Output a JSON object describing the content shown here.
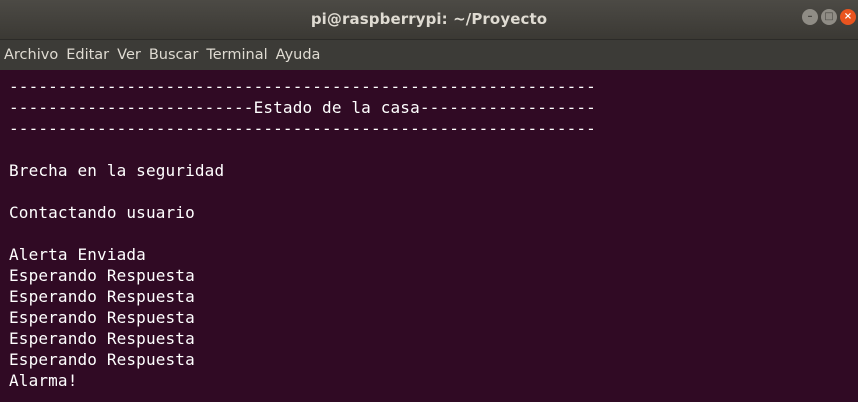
{
  "window": {
    "title": "pi@raspberrypi: ~/Proyecto",
    "controls": {
      "minimize_icon": "minimize-icon",
      "maximize_icon": "maximize-icon",
      "close_icon": "close-icon"
    }
  },
  "menubar": {
    "items": [
      "Archivo",
      "Editar",
      "Ver",
      "Buscar",
      "Terminal",
      "Ayuda"
    ]
  },
  "terminal": {
    "background": "#300a24",
    "foreground": "#ffffff",
    "lines": [
      "------------------------------------------------------------",
      "-------------------------Estado de la casa------------------",
      "------------------------------------------------------------",
      "",
      "Brecha en la seguridad",
      "",
      "Contactando usuario",
      "",
      "Alerta Enviada",
      "Esperando Respuesta",
      "Esperando Respuesta",
      "Esperando Respuesta",
      "Esperando Respuesta",
      "Esperando Respuesta",
      "Alarma!"
    ]
  }
}
